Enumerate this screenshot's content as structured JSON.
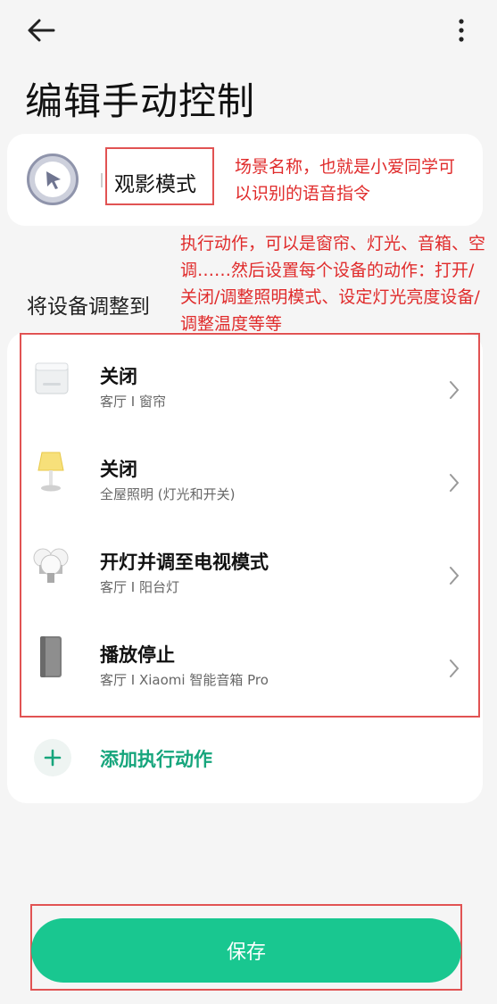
{
  "header": {
    "back_icon": "arrow-left-icon",
    "more_icon": "more-vertical-icon",
    "title": "编辑手动控制"
  },
  "scene": {
    "icon": "cursor-arrow-icon",
    "name": "观影模式",
    "accent_color": "#8f94ab"
  },
  "annotations": {
    "scene_note": "场景名称，也就是小爱同学可以识别的语音指令",
    "action_note": "执行动作，可以是窗帘、灯光、音箱、空调……然后设置每个设备的动作：打开/关闭/调整照明模式、设定灯光亮度设备/调整温度等等",
    "color": "#e02b2b"
  },
  "section": {
    "label": "将设备调整到"
  },
  "actions": [
    {
      "icon": "curtain-motor-icon",
      "title": "关闭",
      "subtitle": "客厅 I 窗帘"
    },
    {
      "icon": "lamp-icon",
      "title": "关闭",
      "subtitle": "全屋照明 (灯光和开关)"
    },
    {
      "icon": "light-bulbs-icon",
      "title": "开灯并调至电视模式",
      "subtitle": "客厅 I 阳台灯"
    },
    {
      "icon": "speaker-icon",
      "title": "播放停止",
      "subtitle": "客厅 I Xiaomi 智能音箱 Pro"
    }
  ],
  "add_action": {
    "icon": "plus-icon",
    "label": "添加执行动作",
    "color": "#16a57c"
  },
  "footer": {
    "save_label": "保存",
    "save_color": "#19c790"
  }
}
